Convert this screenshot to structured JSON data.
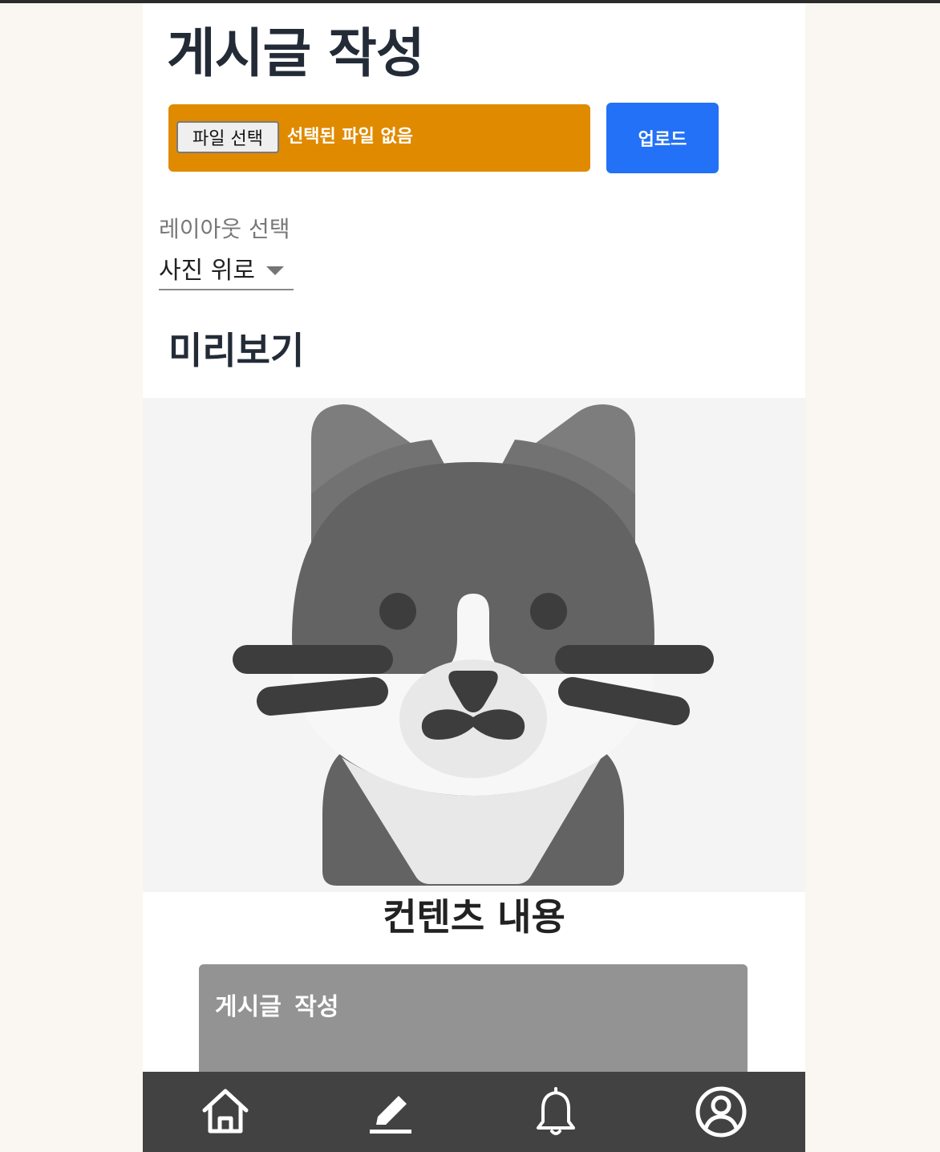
{
  "header": {
    "title": "게시글 작성"
  },
  "file_input": {
    "button_label": "파일 선택",
    "status_text": "선택된 파일 없음"
  },
  "upload": {
    "label": "업로드"
  },
  "layout": {
    "label": "레이아웃 선택",
    "selected": "사진 위로"
  },
  "preview": {
    "title": "미리보기",
    "image_icon": "cat-icon",
    "content_title": "컨텐츠 내용",
    "card_title": "게시글 작성"
  },
  "bottom_nav": {
    "items": [
      {
        "icon": "home-icon"
      },
      {
        "icon": "pencil-icon"
      },
      {
        "icon": "bell-icon"
      },
      {
        "icon": "profile-icon"
      }
    ]
  },
  "colors": {
    "file_box": "#e08a00",
    "upload_button": "#2271f7",
    "nav_background": "#424242",
    "card_background": "#939393"
  }
}
